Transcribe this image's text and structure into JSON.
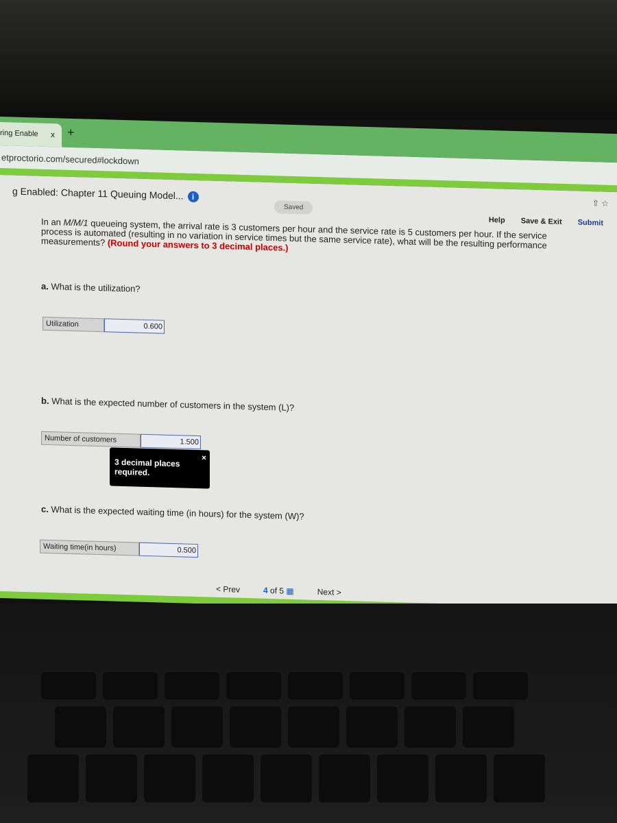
{
  "browser": {
    "tab_title": "ring Enable",
    "tab_close": "x",
    "new_tab": "+",
    "url": "etproctorio.com/secured#lockdown"
  },
  "header": {
    "title": "g Enabled: Chapter 11 Queuing Model...",
    "info": "i",
    "saved": "Saved",
    "help": "Help",
    "save_exit": "Save & Exit",
    "submit": "Submit"
  },
  "question": {
    "text_pre": "In an ",
    "model": "M/M/1",
    "text_post": " queueing system, the arrival rate is 3 customers per hour and the service rate is 5 customers per hour. If the service process is automated (resulting in no variation in service times but the same service rate), what will be the resulting performance measurements? ",
    "instruction": "(Round your answers to 3 decimal places.)"
  },
  "parts": [
    {
      "prefix": "a.",
      "question": "What is the utilization?",
      "label": "Utilization",
      "value": "0.600"
    },
    {
      "prefix": "b.",
      "question": "What is the expected number of customers in the system (L)?",
      "label": "Number of customers",
      "value": "1.500"
    },
    {
      "prefix": "c.",
      "question": "What is the expected waiting time (in hours) for the system (W)?",
      "label": "Waiting time(in hours)",
      "value": "0.500"
    }
  ],
  "tooltip": {
    "text": "3 decimal places required.",
    "close": "×"
  },
  "nav": {
    "prev": "< Prev",
    "current": "4",
    "of": "of 5",
    "next": "Next >"
  },
  "colors": {
    "accent_green": "#7ecb3e",
    "submit_blue": "#1a3e8a",
    "error_red": "#cc0000"
  }
}
